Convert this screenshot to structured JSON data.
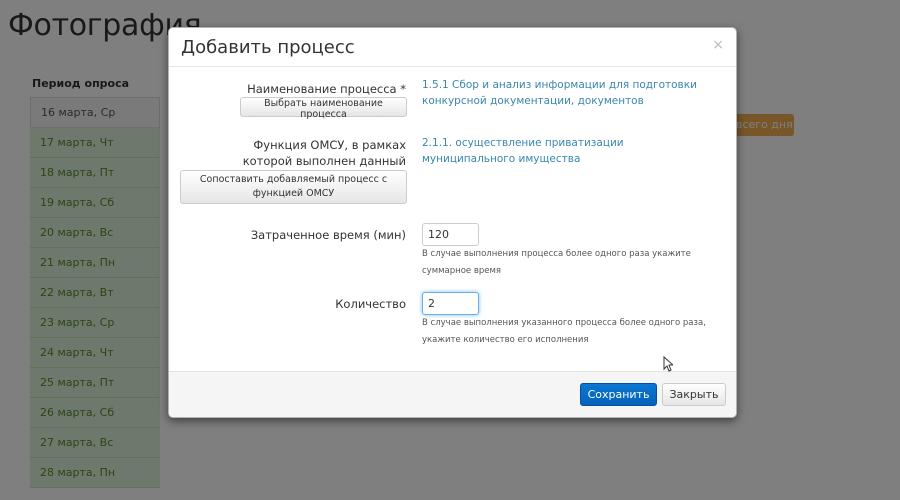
{
  "background": {
    "page_title": "Фотография",
    "sidebar_header": "Период опроса",
    "days": [
      "16 марта, Ср",
      "17 марта, Чт",
      "18 марта, Пт",
      "19 марта, Сб",
      "20 марта, Вс",
      "21 марта, Пн",
      "22 марта, Вт",
      "23 марта, Ср",
      "24 марта, Чт",
      "25 марта, Пт",
      "26 марта, Сб",
      "27 марта, Вс",
      "28 марта, Пн"
    ],
    "orange_button": "всего дня"
  },
  "modal": {
    "title": "Добавить процесс",
    "close_glyph": "×",
    "process_name": {
      "label": "Наименование процесса *",
      "button": "Выбрать наименование процесса",
      "value": "1.5.1 Сбор и анализ информации для подготовки конкурсной документации, документов"
    },
    "omsu_function": {
      "label": "Функция ОМСУ, в рамках которой выполнен данный процесс *",
      "button": "Сопоставить добавляемый процесс с функцией ОМСУ",
      "value": "2.1.1. осуществление приватизации муниципального имущества"
    },
    "time_spent": {
      "label": "Затраченное время (мин)",
      "value": "120",
      "help": "В случае выполнения процесса более одного раза укажите суммарное время"
    },
    "quantity": {
      "label": "Количество",
      "value": "2",
      "help": "В случае выполнения указанного процесса более одного раза, укажите количество его исполнения"
    },
    "footer": {
      "save": "Сохранить",
      "close": "Закрыть"
    }
  },
  "colors": {
    "primary": "#0a6fcc",
    "link": "#3a87ad",
    "day_bg": "#dff0d8",
    "orange": "#f0ad4e"
  }
}
